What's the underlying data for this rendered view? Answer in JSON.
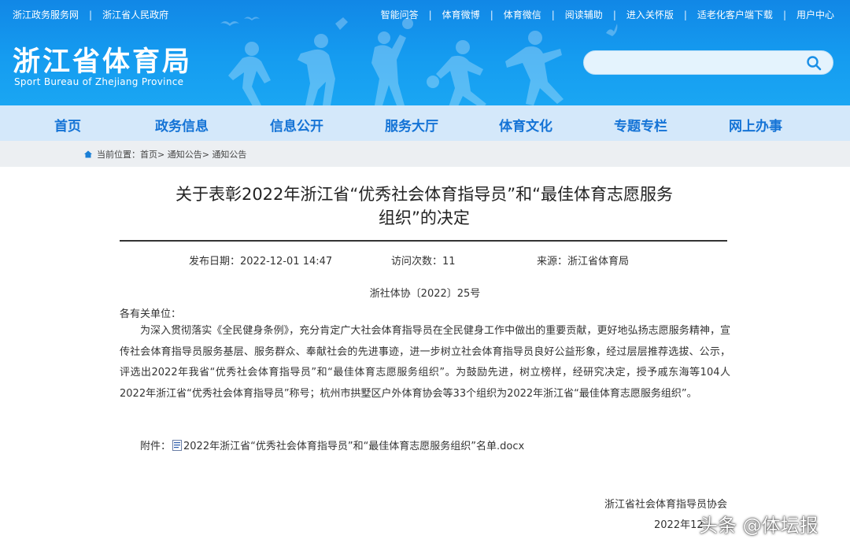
{
  "colors": {
    "header_blue": "#1498ee",
    "nav_bg": "#d4e8fa",
    "nav_text": "#1473d6",
    "crumb_bg": "#eceff2"
  },
  "topbar": {
    "left_links": [
      "浙江政务服务网",
      "浙江省人民政府"
    ],
    "right_links": [
      "智能问答",
      "体育微博",
      "体育微信",
      "阅读辅助",
      "进入关怀版",
      "适老化客户端下载",
      "用户中心"
    ]
  },
  "site": {
    "title": "浙江省体育局",
    "subtitle": "Sport Bureau of Zhejiang Province"
  },
  "search": {
    "placeholder": "",
    "icon": "search-icon"
  },
  "nav": [
    "首页",
    "政务信息",
    "信息公开",
    "服务大厅",
    "体育文化",
    "专题专栏",
    "网上办事"
  ],
  "breadcrumb": {
    "prefix": "当前位置：",
    "items": [
      "首页",
      "通知公告",
      "通知公告"
    ],
    "separator": ">"
  },
  "article": {
    "title_line1": "关于表彰2022年浙江省“优秀社会体育指导员”和“最佳体育志愿服务",
    "title_line2": "组织”的决定",
    "publish_label": "发布日期：",
    "publish_date": "2022-12-01 14:47",
    "visits_label": "访问次数：",
    "visits": "11",
    "source_label": "来源：",
    "source": "浙江省体育局",
    "doc_number": "浙社体协〔2022〕25号",
    "salutation": "各有关单位：",
    "body": "为深入贯彻落实《全民健身条例》，充分肯定广大社会体育指导员在全民健身工作中做出的重要贡献，更好地弘扬志愿服务精神，宣传社会体育指导员服务基层、服务群众、奉献社会的先进事迹，进一步树立社会体育指导员良好公益形象，经过层层推荐选拔、公示，评选出2022年我省“优秀社会体育指导员”和“最佳体育志愿服务组织”。为鼓励先进，树立榜样，经研究决定，授予戚东海等104人2022年浙江省“优秀社会体育指导员”称号；杭州市拱墅区户外体育协会等33个组织为2022年浙江省“最佳体育志愿服务组织”。",
    "attachment_label": "附件：",
    "attachment_name": "2022年浙江省“优秀社会体育指导员”和“最佳体育志愿服务组织”名单.docx",
    "signer": "浙江省社会体育指导员协会",
    "sign_date": "2022年12月1日"
  },
  "watermark": "头条 @体坛报"
}
